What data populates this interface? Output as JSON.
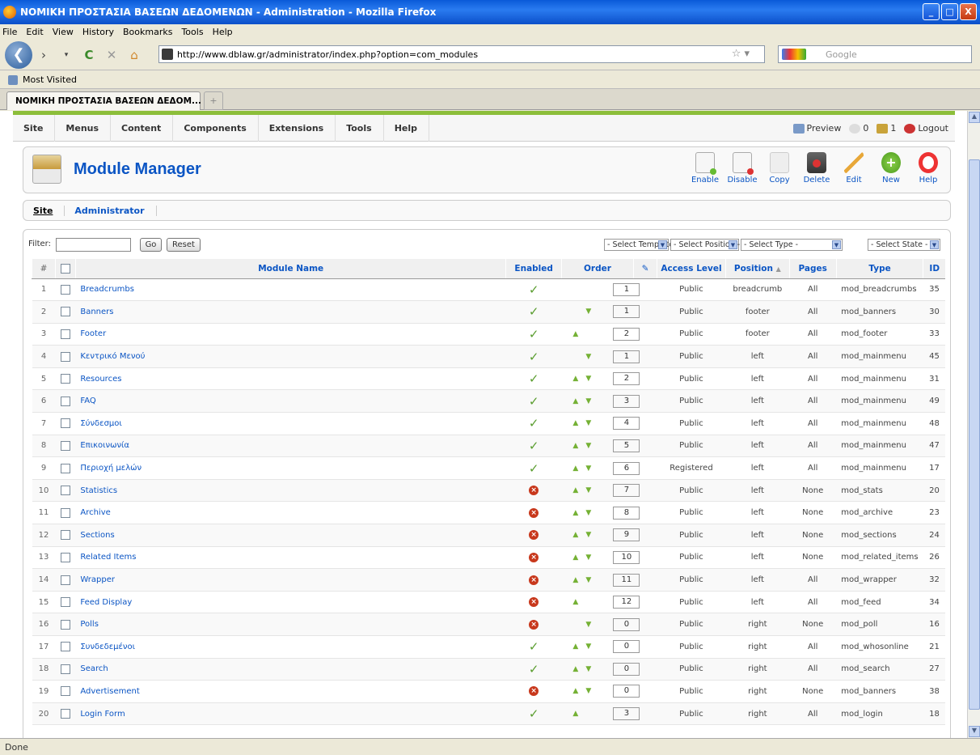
{
  "window": {
    "title": "ΝΟΜΙΚΗ ΠΡΟΣΤΑΣΙΑ ΒΑΣΕΩΝ ΔΕΔΟΜΕΝΩΝ - Administration - Mozilla Firefox",
    "minimize": "_",
    "maximize": "□",
    "close": "X"
  },
  "menubar": [
    "File",
    "Edit",
    "View",
    "History",
    "Bookmarks",
    "Tools",
    "Help"
  ],
  "navbar": {
    "url": "http://www.dblaw.gr/administrator/index.php?option=com_modules",
    "search_placeholder": "Google"
  },
  "bookmarks": {
    "most_visited": "Most Visited"
  },
  "tab": {
    "title": "ΝΟΜΙΚΗ ΠΡΟΣΤΑΣΙΑ ΒΑΣΕΩΝ ΔΕΔΟΜ...",
    "new_tab": "+"
  },
  "cms_menu": [
    "Site",
    "Menus",
    "Content",
    "Components",
    "Extensions",
    "Tools",
    "Help"
  ],
  "cms_status": {
    "preview": "Preview",
    "messages": "0",
    "users": "1",
    "logout": "Logout"
  },
  "page_title": "Module Manager",
  "toolbar": [
    "Enable",
    "Disable",
    "Copy",
    "Delete",
    "Edit",
    "New",
    "Help"
  ],
  "subnav": [
    "Site",
    "Administrator"
  ],
  "filter": {
    "label": "Filter:",
    "go": "Go",
    "reset": "Reset",
    "selects": [
      "- Select Template -",
      "- Select Position -",
      "- Select Type -",
      "- Select State -"
    ]
  },
  "columns": {
    "num": "#",
    "name": "Module Name",
    "enabled": "Enabled",
    "order": "Order",
    "access": "Access Level",
    "position": "Position",
    "pages": "Pages",
    "type": "Type",
    "id": "ID"
  },
  "rows": [
    {
      "n": "1",
      "name": "Breadcrumbs",
      "enabled": true,
      "up": false,
      "down": false,
      "order": "1",
      "access": "Public",
      "position": "breadcrumb",
      "pages": "All",
      "type": "mod_breadcrumbs",
      "id": "35"
    },
    {
      "n": "2",
      "name": "Banners",
      "enabled": true,
      "up": false,
      "down": true,
      "order": "1",
      "access": "Public",
      "position": "footer",
      "pages": "All",
      "type": "mod_banners",
      "id": "30"
    },
    {
      "n": "3",
      "name": "Footer",
      "enabled": true,
      "up": true,
      "down": false,
      "order": "2",
      "access": "Public",
      "position": "footer",
      "pages": "All",
      "type": "mod_footer",
      "id": "33"
    },
    {
      "n": "4",
      "name": "Κεντρικό Μενού",
      "enabled": true,
      "up": false,
      "down": true,
      "order": "1",
      "access": "Public",
      "position": "left",
      "pages": "All",
      "type": "mod_mainmenu",
      "id": "45"
    },
    {
      "n": "5",
      "name": "Resources",
      "enabled": true,
      "up": true,
      "down": true,
      "order": "2",
      "access": "Public",
      "position": "left",
      "pages": "All",
      "type": "mod_mainmenu",
      "id": "31"
    },
    {
      "n": "6",
      "name": "FAQ",
      "enabled": true,
      "up": true,
      "down": true,
      "order": "3",
      "access": "Public",
      "position": "left",
      "pages": "All",
      "type": "mod_mainmenu",
      "id": "49"
    },
    {
      "n": "7",
      "name": "Σύνδεσμοι",
      "enabled": true,
      "up": true,
      "down": true,
      "order": "4",
      "access": "Public",
      "position": "left",
      "pages": "All",
      "type": "mod_mainmenu",
      "id": "48"
    },
    {
      "n": "8",
      "name": "Επικοινωνία",
      "enabled": true,
      "up": true,
      "down": true,
      "order": "5",
      "access": "Public",
      "position": "left",
      "pages": "All",
      "type": "mod_mainmenu",
      "id": "47"
    },
    {
      "n": "9",
      "name": "Περιοχή μελών",
      "enabled": true,
      "up": true,
      "down": true,
      "order": "6",
      "access": "Registered",
      "position": "left",
      "pages": "All",
      "type": "mod_mainmenu",
      "id": "17"
    },
    {
      "n": "10",
      "name": "Statistics",
      "enabled": false,
      "up": true,
      "down": true,
      "order": "7",
      "access": "Public",
      "position": "left",
      "pages": "None",
      "type": "mod_stats",
      "id": "20"
    },
    {
      "n": "11",
      "name": "Archive",
      "enabled": false,
      "up": true,
      "down": true,
      "order": "8",
      "access": "Public",
      "position": "left",
      "pages": "None",
      "type": "mod_archive",
      "id": "23"
    },
    {
      "n": "12",
      "name": "Sections",
      "enabled": false,
      "up": true,
      "down": true,
      "order": "9",
      "access": "Public",
      "position": "left",
      "pages": "None",
      "type": "mod_sections",
      "id": "24"
    },
    {
      "n": "13",
      "name": "Related Items",
      "enabled": false,
      "up": true,
      "down": true,
      "order": "10",
      "access": "Public",
      "position": "left",
      "pages": "None",
      "type": "mod_related_items",
      "id": "26"
    },
    {
      "n": "14",
      "name": "Wrapper",
      "enabled": false,
      "up": true,
      "down": true,
      "order": "11",
      "access": "Public",
      "position": "left",
      "pages": "All",
      "type": "mod_wrapper",
      "id": "32"
    },
    {
      "n": "15",
      "name": "Feed Display",
      "enabled": false,
      "up": true,
      "down": false,
      "order": "12",
      "access": "Public",
      "position": "left",
      "pages": "All",
      "type": "mod_feed",
      "id": "34"
    },
    {
      "n": "16",
      "name": "Polls",
      "enabled": false,
      "up": false,
      "down": true,
      "order": "0",
      "access": "Public",
      "position": "right",
      "pages": "None",
      "type": "mod_poll",
      "id": "16"
    },
    {
      "n": "17",
      "name": "Συνδεδεμένοι",
      "enabled": true,
      "up": true,
      "down": true,
      "order": "0",
      "access": "Public",
      "position": "right",
      "pages": "All",
      "type": "mod_whosonline",
      "id": "21"
    },
    {
      "n": "18",
      "name": "Search",
      "enabled": true,
      "up": true,
      "down": true,
      "order": "0",
      "access": "Public",
      "position": "right",
      "pages": "All",
      "type": "mod_search",
      "id": "27"
    },
    {
      "n": "19",
      "name": "Advertisement",
      "enabled": false,
      "up": true,
      "down": true,
      "order": "0",
      "access": "Public",
      "position": "right",
      "pages": "None",
      "type": "mod_banners",
      "id": "38"
    },
    {
      "n": "20",
      "name": "Login Form",
      "enabled": true,
      "up": true,
      "down": false,
      "order": "3",
      "access": "Public",
      "position": "right",
      "pages": "All",
      "type": "mod_login",
      "id": "18"
    }
  ],
  "status": "Done",
  "colors": {
    "link": "#0b55c4",
    "accent": "#8cbe3a",
    "enabled": "#5a9d2f",
    "disabled": "#c8381c",
    "registered": "#cc0000"
  }
}
